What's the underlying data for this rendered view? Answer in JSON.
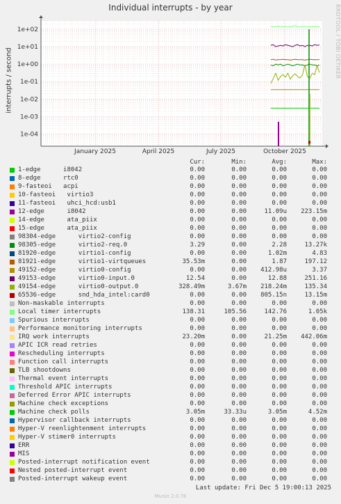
{
  "title": "Individual interrupts - by year",
  "side_label": "RRDTOOL / TOBI OETIKER",
  "footer": {
    "last_update": "Last update: Fri Dec  5 19:00:13 2025",
    "generator": "Munin 2.0.76"
  },
  "legend_headers": {
    "cur": "Cur:",
    "min": "Min:",
    "avg": "Avg:",
    "max": "Max:"
  },
  "chart_data": {
    "type": "line",
    "title": "Individual interrupts - by year",
    "ylabel": "interrupts / second",
    "yscale": "log",
    "ylim": [
      2e-05,
      300
    ],
    "y_ticks": [
      {
        "label": "1e+02",
        "value": 100
      },
      {
        "label": "1e+01",
        "value": 10
      },
      {
        "label": "1e+00",
        "value": 1
      },
      {
        "label": "1e-01",
        "value": 0.1
      },
      {
        "label": "1e-02",
        "value": 0.01
      },
      {
        "label": "1e-03",
        "value": 0.001
      },
      {
        "label": "1e-04",
        "value": 0.0001
      }
    ],
    "x_ticks": [
      "January 2025",
      "April 2025",
      "July 2025",
      "October 2025"
    ],
    "grid": true,
    "series": [
      {
        "name": "1-edge      i8042",
        "color": "#00cc00",
        "cur": "0.00",
        "min": "0.00",
        "avg": "0.00",
        "max": "0.00"
      },
      {
        "name": "8-edge      rtc0",
        "color": "#0066b3",
        "cur": "0.00",
        "min": "0.00",
        "avg": "0.00",
        "max": "0.00"
      },
      {
        "name": "9-fasteoi   acpi",
        "color": "#ff8000",
        "cur": "0.00",
        "min": "0.00",
        "avg": "0.00",
        "max": "0.00"
      },
      {
        "name": "10-fasteoi   virtio3",
        "color": "#ffcc00",
        "cur": "0.00",
        "min": "0.00",
        "avg": "0.00",
        "max": "0.00"
      },
      {
        "name": "11-fasteoi   uhci_hcd:usb1",
        "color": "#330099",
        "cur": "0.00",
        "min": "0.00",
        "avg": "0.00",
        "max": "0.00"
      },
      {
        "name": "12-edge      i8042",
        "color": "#990099",
        "cur": "0.00",
        "min": "0.00",
        "avg": "11.09u",
        "max": "223.15m"
      },
      {
        "name": "14-edge      ata_piix",
        "color": "#ccff00",
        "cur": "0.00",
        "min": "0.00",
        "avg": "0.00",
        "max": "0.00"
      },
      {
        "name": "15-edge      ata_piix",
        "color": "#ff0000",
        "cur": "0.00",
        "min": "0.00",
        "avg": "0.00",
        "max": "0.00"
      },
      {
        "name": "98304-edge      virtio2-config",
        "color": "#808080",
        "cur": "0.00",
        "min": "0.00",
        "avg": "0.00",
        "max": "0.00"
      },
      {
        "name": "98305-edge      virtio2-req.0",
        "color": "#008f00",
        "cur": "3.29",
        "min": "0.00",
        "avg": "2.28",
        "max": "13.27k"
      },
      {
        "name": "81920-edge      virtio1-config",
        "color": "#00487d",
        "cur": "0.00",
        "min": "0.00",
        "avg": "1.02m",
        "max": "4.83"
      },
      {
        "name": "81921-edge      virtio1-virtqueues",
        "color": "#b35a00",
        "cur": "35.53m",
        "min": "0.00",
        "avg": "1.87",
        "max": "197.12"
      },
      {
        "name": "49152-edge      virtio0-config",
        "color": "#b38f00",
        "cur": "0.00",
        "min": "0.00",
        "avg": "412.98u",
        "max": "3.37"
      },
      {
        "name": "49153-edge      virtio0-input.0",
        "color": "#6b006b",
        "cur": "12.54",
        "min": "0.00",
        "avg": "12.88",
        "max": "251.16"
      },
      {
        "name": "49154-edge      virtio0-output.0",
        "color": "#8fb300",
        "cur": "328.49m",
        "min": "3.67m",
        "avg": "218.24m",
        "max": "135.34"
      },
      {
        "name": "65536-edge      snd_hda_intel:card0",
        "color": "#b30000",
        "cur": "0.00",
        "min": "0.00",
        "avg": "805.15n",
        "max": "13.15m"
      },
      {
        "name": "Non-maskable interrupts",
        "color": "#bebebe",
        "cur": "0.00",
        "min": "0.00",
        "avg": "0.00",
        "max": "0.00"
      },
      {
        "name": "Local timer interrupts",
        "color": "#80ff80",
        "cur": "138.31",
        "min": "105.56",
        "avg": "142.76",
        "max": "1.05k"
      },
      {
        "name": "Spurious interrupts",
        "color": "#80c9ff",
        "cur": "0.00",
        "min": "0.00",
        "avg": "0.00",
        "max": "0.00"
      },
      {
        "name": "Performance monitoring interrupts",
        "color": "#ffc080",
        "cur": "0.00",
        "min": "0.00",
        "avg": "0.00",
        "max": "0.00"
      },
      {
        "name": "IRQ work interrupts",
        "color": "#ffe680",
        "cur": "23.20m",
        "min": "0.00",
        "avg": "21.25m",
        "max": "442.06m"
      },
      {
        "name": "APIC ICR read retries",
        "color": "#aa80ff",
        "cur": "0.00",
        "min": "0.00",
        "avg": "0.00",
        "max": "0.00"
      },
      {
        "name": "Rescheduling interrupts",
        "color": "#ee00cc",
        "cur": "0.00",
        "min": "0.00",
        "avg": "0.00",
        "max": "0.00"
      },
      {
        "name": "Function call interrupts",
        "color": "#ff8080",
        "cur": "0.00",
        "min": "0.00",
        "avg": "0.00",
        "max": "0.00"
      },
      {
        "name": "TLB shootdowns",
        "color": "#666600",
        "cur": "0.00",
        "min": "0.00",
        "avg": "0.00",
        "max": "0.00"
      },
      {
        "name": "Thermal event interrupts",
        "color": "#ffbfff",
        "cur": "0.00",
        "min": "0.00",
        "avg": "0.00",
        "max": "0.00"
      },
      {
        "name": "Threshold APIC interrupts",
        "color": "#00ffcc",
        "cur": "0.00",
        "min": "0.00",
        "avg": "0.00",
        "max": "0.00"
      },
      {
        "name": "Deferred Error APIC interrupts",
        "color": "#cc6699",
        "cur": "0.00",
        "min": "0.00",
        "avg": "0.00",
        "max": "0.00"
      },
      {
        "name": "Machine check exceptions",
        "color": "#999900",
        "cur": "0.00",
        "min": "0.00",
        "avg": "0.00",
        "max": "0.00"
      },
      {
        "name": "Machine check polls",
        "color": "#00cc00",
        "cur": "3.05m",
        "min": "33.33u",
        "avg": "3.05m",
        "max": "4.52m"
      },
      {
        "name": "Hypervisor callback interrupts",
        "color": "#0066b3",
        "cur": "0.00",
        "min": "0.00",
        "avg": "0.00",
        "max": "0.00"
      },
      {
        "name": "Hyper-V reenlightenment interrupts",
        "color": "#ff8000",
        "cur": "0.00",
        "min": "0.00",
        "avg": "0.00",
        "max": "0.00"
      },
      {
        "name": "Hyper-V stimer0 interrupts",
        "color": "#ffcc00",
        "cur": "0.00",
        "min": "0.00",
        "avg": "0.00",
        "max": "0.00"
      },
      {
        "name": "ERR",
        "color": "#330099",
        "cur": "0.00",
        "min": "0.00",
        "avg": "0.00",
        "max": "0.00"
      },
      {
        "name": "MIS",
        "color": "#990099",
        "cur": "0.00",
        "min": "0.00",
        "avg": "0.00",
        "max": "0.00"
      },
      {
        "name": "Posted-interrupt notification event",
        "color": "#ccff00",
        "cur": "0.00",
        "min": "0.00",
        "avg": "0.00",
        "max": "0.00"
      },
      {
        "name": "Nested posted-interrupt event",
        "color": "#ff0000",
        "cur": "0.00",
        "min": "0.00",
        "avg": "0.00",
        "max": "0.00"
      },
      {
        "name": "Posted-interrupt wakeup event",
        "color": "#808080",
        "cur": "0.00",
        "min": "0.00",
        "avg": "0.00",
        "max": "0.00"
      }
    ]
  }
}
